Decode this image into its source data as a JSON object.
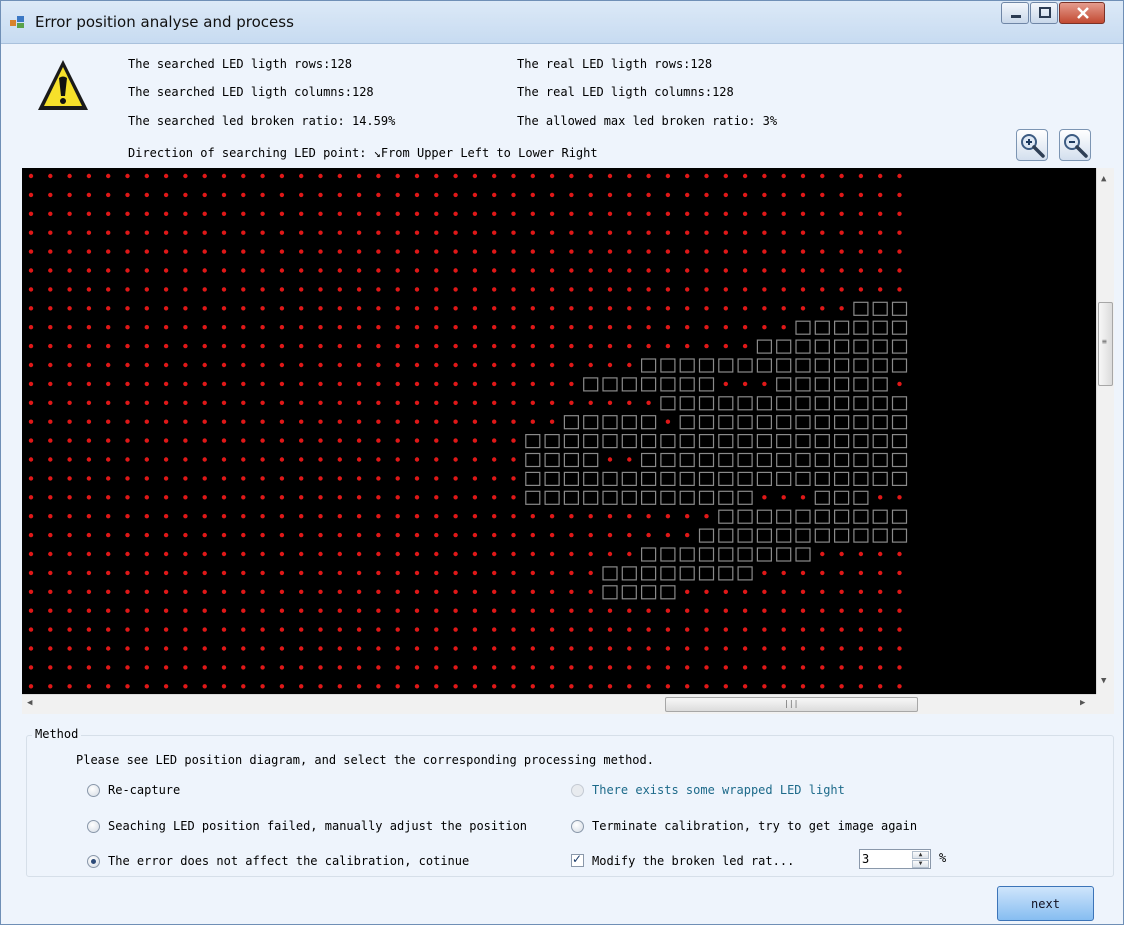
{
  "window": {
    "title": "Error position analyse and process"
  },
  "info": {
    "searched_rows": "The searched LED ligth rows:128",
    "searched_columns": "The searched LED ligth columns:128",
    "searched_ratio": "The searched led broken ratio: 14.59%",
    "real_rows": "The real LED ligth rows:128",
    "real_columns": "The real LED ligth columns:128",
    "allowed_ratio": "The allowed max led broken ratio: 3%",
    "direction": "Direction of searching LED point: ↘From Upper Left to Lower Right"
  },
  "icons": {
    "warning": "warning-icon",
    "zoom_in": "zoom-in-icon",
    "zoom_out": "zoom-out-icon"
  },
  "colors": {
    "led": "#e01818",
    "broken_marker": "#8a8a8a",
    "viewer_background": "#000000",
    "accent_button": "#86bdf1"
  },
  "method": {
    "group_title": "Method",
    "description": "Please see LED position diagram, and select the corresponding processing method.",
    "options": {
      "recapture": "Re-capture",
      "wrapped": "There exists some wrapped LED light",
      "manual": "Seaching LED position failed, manually adjust the position",
      "terminate": "Terminate calibration, try to get image again",
      "continue": "The error does not affect the calibration, cotinue",
      "modify_ratio": "Modify the broken led rat..."
    },
    "selected": "continue",
    "modify_ratio_checked": true,
    "ratio_value": "3",
    "ratio_unit": "%"
  },
  "buttons": {
    "next": "next"
  }
}
